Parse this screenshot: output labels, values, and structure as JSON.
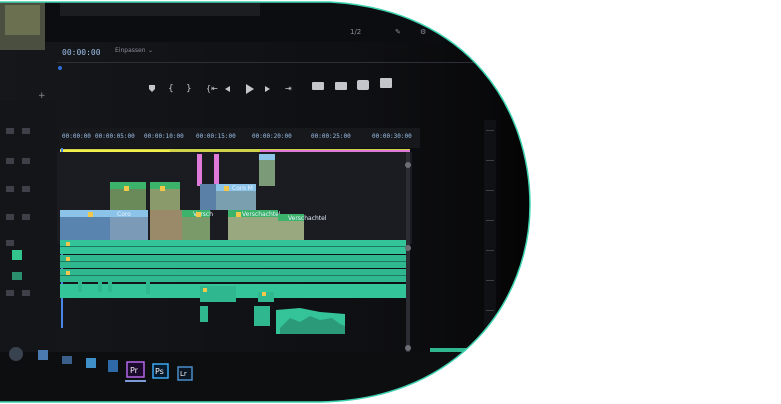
{
  "app": {
    "timecode": "00:00:00",
    "zoom_label": "Einpassen",
    "fraction_label": "1/2",
    "program_timecode": "00:00:00"
  },
  "ruler": {
    "ticks": [
      "00:00:00",
      "00:00:05:00",
      "00:00:10:00",
      "00:00:15:00",
      "00:00:20:00",
      "00:00:25:00",
      "00:00:30:00"
    ]
  },
  "clips": {
    "coro_label": "Coro M",
    "versch_1": "Versch",
    "versch_2": "Verschachtel",
    "versch_3": "Verschachtel",
    "coro_small": "Coro"
  },
  "taskbar": {
    "premiere": "Pr",
    "photoshop": "Ps",
    "lightroom": "Lr"
  },
  "colors": {
    "panel": "#111317",
    "timeline": "#1b1d22",
    "video_clip": "#8cc3e8",
    "audio_clip": "#35c49a",
    "pink_clip": "#e07ad8",
    "green_badge": "#3bb36a",
    "ring_border": "#3fd3b1"
  }
}
